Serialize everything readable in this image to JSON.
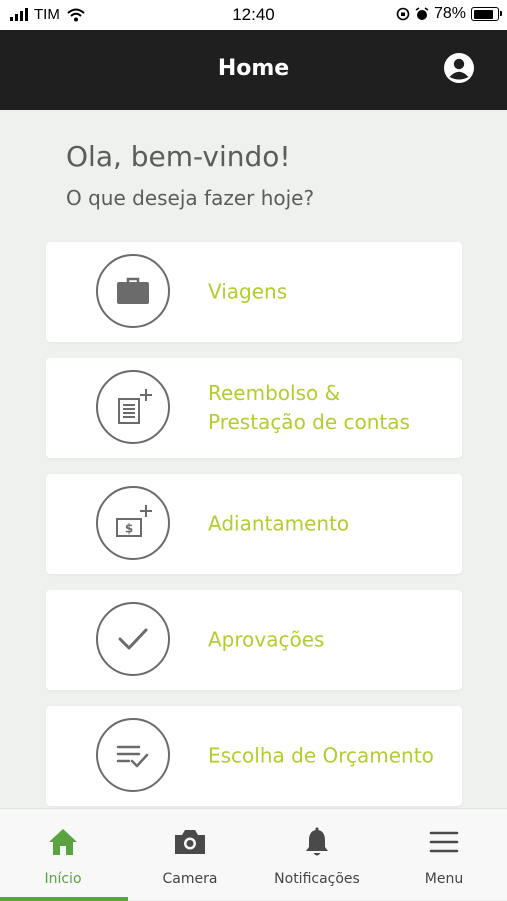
{
  "status_bar": {
    "carrier": "TIM",
    "time": "12:40",
    "battery": "78%"
  },
  "header": {
    "title": "Home",
    "profile_icon": "account-circle-icon"
  },
  "greeting": {
    "title": "Ola, bem-vindo!",
    "subtitle": "O que deseja fazer hoje?"
  },
  "menu_cards": [
    {
      "line1": "Viagens",
      "line2": "",
      "icon": "briefcase-icon"
    },
    {
      "line1": "Reembolso &",
      "line2": "Prestação de contas",
      "icon": "receipt-add-icon"
    },
    {
      "line1": "Adiantamento",
      "line2": "",
      "icon": "money-add-icon"
    },
    {
      "line1": "Aprovações",
      "line2": "",
      "icon": "checkmark-icon"
    },
    {
      "line1": "Escolha de Orçamento",
      "line2": "",
      "icon": "list-check-icon"
    }
  ],
  "bottom_nav": [
    {
      "label": "Início",
      "icon": "home-icon",
      "active": true
    },
    {
      "label": "Camera",
      "icon": "camera-icon",
      "active": false
    },
    {
      "label": "Notificações",
      "icon": "bell-icon",
      "active": false
    },
    {
      "label": "Menu",
      "icon": "hamburger-menu-icon",
      "active": false
    }
  ],
  "colors": {
    "accent": "#b4cc2e",
    "active_nav": "#5aa340",
    "header_bg": "#1f1f1f",
    "background": "#eef1ee",
    "icon_gray": "#6b6b6b"
  }
}
